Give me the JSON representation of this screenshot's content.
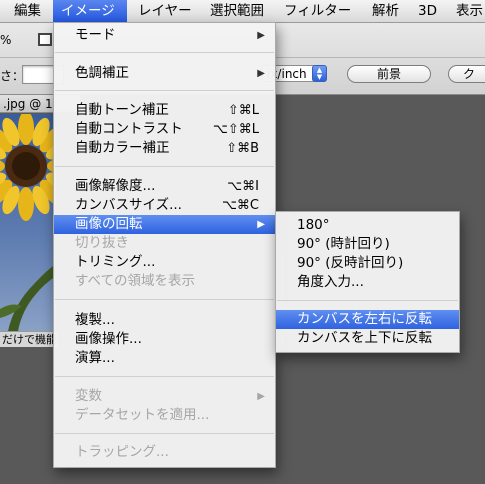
{
  "menubar": {
    "items": [
      {
        "label": "編集"
      },
      {
        "label": "イメージ"
      },
      {
        "label": "レイヤー"
      },
      {
        "label": "選択範囲"
      },
      {
        "label": "フィルター"
      },
      {
        "label": "解析"
      },
      {
        "label": "3D"
      },
      {
        "label": "表示"
      }
    ]
  },
  "options_bar": {
    "percent_label": "%",
    "size_label": "さ：",
    "unit_label": "ix/inch",
    "front_button": "前景",
    "clear_button": "ク"
  },
  "document": {
    "tab_title": ".jpg @ 1",
    "status_text": "だけで機能"
  },
  "image_menu": {
    "items": [
      {
        "label": "モード",
        "shortcut": "",
        "submenu": true,
        "disabled": false
      },
      {
        "label": "色調補正",
        "shortcut": "",
        "submenu": true,
        "disabled": false
      },
      {
        "label": "自動トーン補正",
        "shortcut": "⇧⌘L",
        "submenu": false,
        "disabled": false
      },
      {
        "label": "自動コントラスト",
        "shortcut": "⌥⇧⌘L",
        "submenu": false,
        "disabled": false
      },
      {
        "label": "自動カラー補正",
        "shortcut": "⇧⌘B",
        "submenu": false,
        "disabled": false
      },
      {
        "label": "画像解像度...",
        "shortcut": "⌥⌘I",
        "submenu": false,
        "disabled": false
      },
      {
        "label": "カンバスサイズ...",
        "shortcut": "⌥⌘C",
        "submenu": false,
        "disabled": false
      },
      {
        "label": "画像の回転",
        "shortcut": "",
        "submenu": true,
        "disabled": false,
        "highlighted": true
      },
      {
        "label": "切り抜き",
        "shortcut": "",
        "submenu": false,
        "disabled": true
      },
      {
        "label": "トリミング...",
        "shortcut": "",
        "submenu": false,
        "disabled": false
      },
      {
        "label": "すべての領域を表示",
        "shortcut": "",
        "submenu": false,
        "disabled": true
      },
      {
        "label": "複製...",
        "shortcut": "",
        "submenu": false,
        "disabled": false
      },
      {
        "label": "画像操作...",
        "shortcut": "",
        "submenu": false,
        "disabled": false
      },
      {
        "label": "演算...",
        "shortcut": "",
        "submenu": false,
        "disabled": false
      },
      {
        "label": "変数",
        "shortcut": "",
        "submenu": true,
        "disabled": true
      },
      {
        "label": "データセットを適用...",
        "shortcut": "",
        "submenu": false,
        "disabled": true
      },
      {
        "label": "トラッピング...",
        "shortcut": "",
        "submenu": false,
        "disabled": true
      }
    ]
  },
  "rotate_submenu": {
    "items": [
      {
        "label": "180°"
      },
      {
        "label": "90° (時計回り)"
      },
      {
        "label": "90° (反時計回り)"
      },
      {
        "label": "角度入力..."
      },
      {
        "label": "カンバスを左右に反転",
        "highlighted": true
      },
      {
        "label": "カンバスを上下に反転"
      }
    ]
  },
  "colors": {
    "highlight": "#2f62e0",
    "menubar_active": "#2357de",
    "disabled_text": "#a6a6a6",
    "workspace": "#595959"
  },
  "icons": {
    "submenu_arrow": "▶",
    "stepper": "▲▼"
  }
}
